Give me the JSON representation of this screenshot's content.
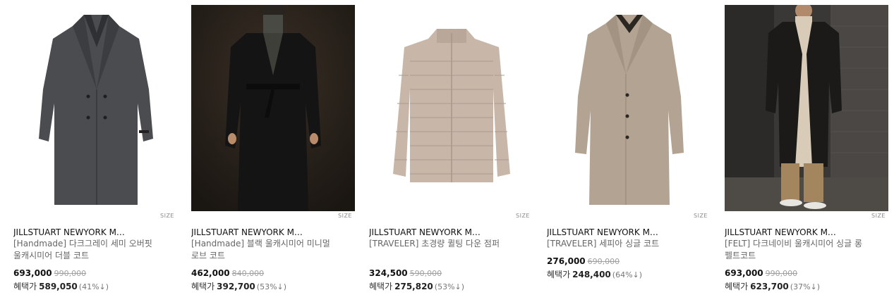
{
  "size_label": "SIZE",
  "products": [
    {
      "brand": "JILLSTUART NEWYORK M…",
      "name": "[Handmade] 다크그레이 세미 오버핏 울캐시미어 더블 코트",
      "price": "693,000",
      "original_price": "990,000",
      "benefit_label": "혜택가",
      "benefit_price": "589,050",
      "benefit_rate": "(41%↓)",
      "image": "dark-grey-double-coat"
    },
    {
      "brand": "JILLSTUART NEWYORK M…",
      "name": "[Handmade] 블랙 울캐시미어 미니멀 로브 코트",
      "price": "462,000",
      "original_price": "840,000",
      "benefit_label": "혜택가",
      "benefit_price": "392,700",
      "benefit_rate": "(53%↓)",
      "image": "black-robe-coat-model"
    },
    {
      "brand": "JILLSTUART NEWYORK M…",
      "name": "[TRAVELER] 초경량 퀼팅 다운 점퍼",
      "price": "324,500",
      "original_price": "590,000",
      "benefit_label": "혜택가",
      "benefit_price": "275,820",
      "benefit_rate": "(53%↓)",
      "image": "beige-quilted-down-jacket"
    },
    {
      "brand": "JILLSTUART NEWYORK M…",
      "name": "[TRAVELER] 세피아 싱글 코트",
      "price": "276,000",
      "original_price": "690,000",
      "benefit_label": "혜택가",
      "benefit_price": "248,400",
      "benefit_rate": "(64%↓)",
      "image": "sepia-single-coat"
    },
    {
      "brand": "JILLSTUART NEWYORK M…",
      "name": "[FELT] 다크네이비 울캐시미어 싱글 롱 펠트코트",
      "price": "693,000",
      "original_price": "990,000",
      "benefit_label": "혜택가",
      "benefit_price": "623,700",
      "benefit_rate": "(37%↓)",
      "image": "dark-navy-long-felt-coat-model"
    }
  ]
}
